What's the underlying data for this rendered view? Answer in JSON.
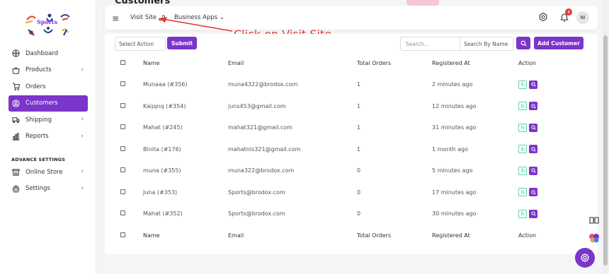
{
  "app": {
    "page_title": "Customers",
    "logo_text": "Sports"
  },
  "sidebar": {
    "items": [
      {
        "label": "Dashboard",
        "icon": "dashboard-icon",
        "chevron": false,
        "active": false
      },
      {
        "label": "Products",
        "icon": "products-icon",
        "chevron": true,
        "active": false
      },
      {
        "label": "Orders",
        "icon": "orders-icon",
        "chevron": false,
        "active": false
      },
      {
        "label": "Customers",
        "icon": "customers-icon",
        "chevron": false,
        "active": true
      },
      {
        "label": "Shipping",
        "icon": "shipping-icon",
        "chevron": true,
        "active": false
      },
      {
        "label": "Reports",
        "icon": "reports-icon",
        "chevron": true,
        "active": false
      }
    ],
    "section_title": "ADVANCE SETTINGS",
    "items2": [
      {
        "label": "Online Store",
        "icon": "store-icon",
        "chevron": true
      },
      {
        "label": "Settings",
        "icon": "settings-icon",
        "chevron": true
      }
    ]
  },
  "header": {
    "visit_site": "Visit Site",
    "business_apps": "Business Apps",
    "notification_count": "4",
    "avatar_initials": "NI"
  },
  "annotation": {
    "text": "Click on Visit Site"
  },
  "toolbar": {
    "select_action": "Select Action",
    "submit": "Submit",
    "search_placeholder": "Search...",
    "search_by": "Search By Name",
    "add_customer": "Add Customer"
  },
  "table": {
    "headers": [
      "Name",
      "Email",
      "Total Orders",
      "Registered At",
      "Action"
    ],
    "rows": [
      [
        "Munaaa (#356)",
        "muna4322@brodox.com",
        "1",
        "2 minutes ago"
      ],
      [
        "Kaijqnq (#354)",
        "juns453@gmail.com",
        "1",
        "12 minutes ago"
      ],
      [
        "Mahat (#245)",
        "mahat321@gmail.com",
        "1",
        "31 minutes ago"
      ],
      [
        "Binita (#176)",
        "mahatnis321@gmail.com",
        "1",
        "1 month ago"
      ],
      [
        "muna (#355)",
        "muna322@brodox.com",
        "0",
        "5 minutes ago"
      ],
      [
        "Juna (#353)",
        "Sports@brodox.com",
        "0",
        "17 minutes ago"
      ],
      [
        "Mahat (#352)",
        "Sports@brodox.com",
        "0",
        "30 minutes ago"
      ]
    ],
    "footers": [
      "Name",
      "Email",
      "Total Orders",
      "Registered At",
      "Action"
    ]
  },
  "colors": {
    "accent": "#7b35c9",
    "annotation": "#e53935",
    "edit_icon": "#5fd3b4"
  }
}
